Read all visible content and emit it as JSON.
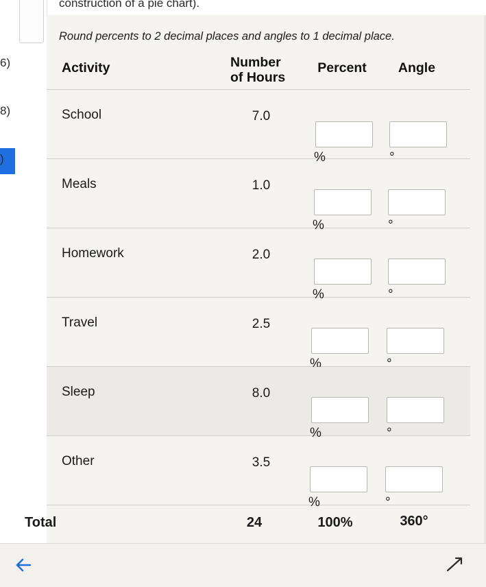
{
  "header": {
    "partial_text": "construction of a pie chart)."
  },
  "gutter": {
    "labels": [
      "6)",
      "8)",
      ")"
    ]
  },
  "worksheet": {
    "instruction": "Round percents to 2 decimal places and angles to 1 decimal place.",
    "columns": {
      "activity": "Activity",
      "hours_line1": "Number",
      "hours_line2": "of Hours",
      "percent": "Percent",
      "angle": "Angle"
    },
    "rows": [
      {
        "activity": "School",
        "hours": "7.0",
        "percent_value": "",
        "percent_unit": "%",
        "angle_value": "",
        "angle_unit": "°"
      },
      {
        "activity": "Meals",
        "hours": "1.0",
        "percent_value": "",
        "percent_unit": "%",
        "angle_value": "",
        "angle_unit": "°"
      },
      {
        "activity": "Homework",
        "hours": "2.0",
        "percent_value": "",
        "percent_unit": "%",
        "angle_value": "",
        "angle_unit": "°"
      },
      {
        "activity": "Travel",
        "hours": "2.5",
        "percent_value": "",
        "percent_unit": "%",
        "angle_value": "",
        "angle_unit": "°"
      },
      {
        "activity": "Sleep",
        "hours": "8.0",
        "percent_value": "",
        "percent_unit": "%",
        "angle_value": "",
        "angle_unit": "°"
      },
      {
        "activity": "Other",
        "hours": "3.5",
        "percent_value": "",
        "percent_unit": "%",
        "angle_value": "",
        "angle_unit": "°"
      }
    ],
    "total": {
      "label": "Total",
      "hours": "24",
      "percent": "100%",
      "angle": "360°"
    }
  },
  "bottom_bar": {
    "back_icon": "arrow-left-icon",
    "forward_icon": "arrow-right-icon"
  },
  "colors": {
    "accent": "#1f6fe0",
    "page_bg": "#f5f4f1",
    "row_shade": "#eceae6",
    "rule": "#cfcdc9"
  }
}
